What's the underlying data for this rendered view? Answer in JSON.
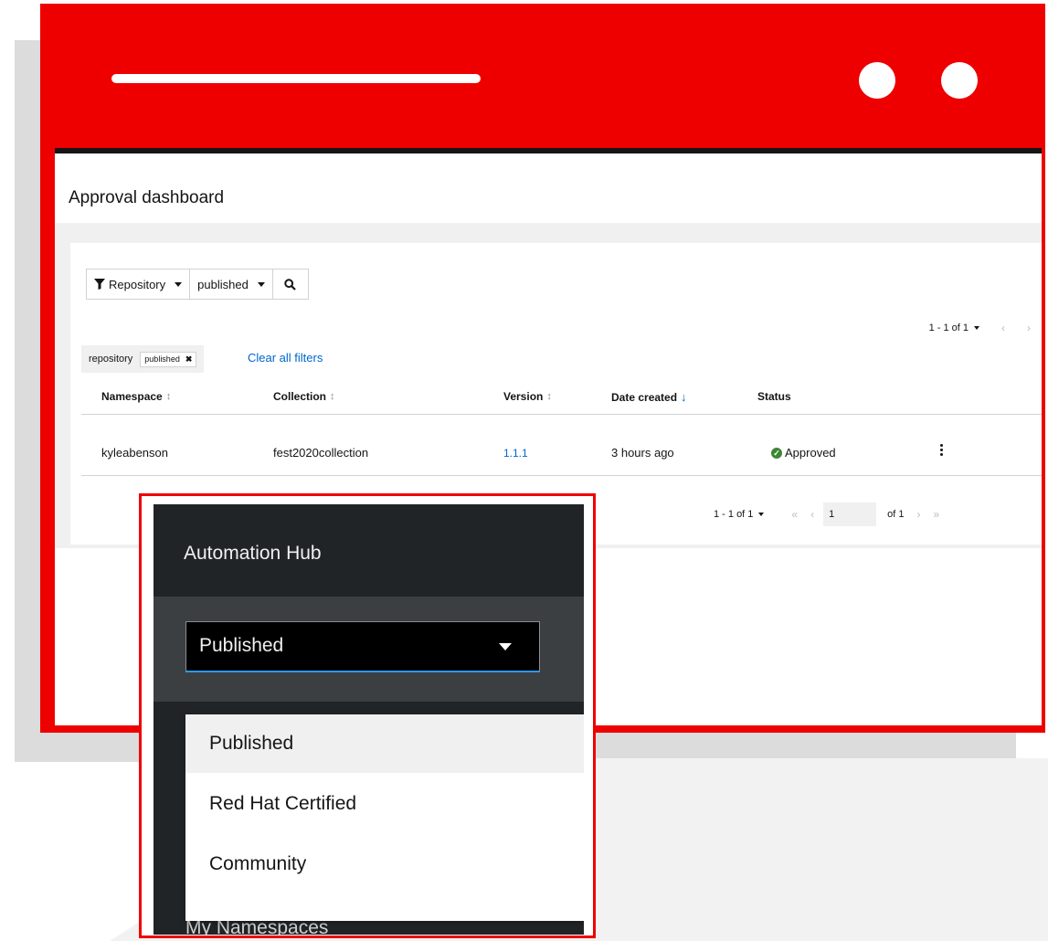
{
  "page": {
    "title": "Approval dashboard"
  },
  "toolbar": {
    "filter_label": "Repository",
    "filter_value": "published",
    "search_icon": "search-icon"
  },
  "pagination_top": {
    "range": "1 - 1 of 1"
  },
  "filters": {
    "chip_category": "repository",
    "chip_value": "published",
    "clear_label": "Clear all filters"
  },
  "table": {
    "headers": [
      "Namespace",
      "Collection",
      "Version",
      "Date created",
      "Status"
    ],
    "rows": [
      {
        "namespace": "kyleabenson",
        "collection": "fest2020collection",
        "version": "1.1.1",
        "date_created": "3 hours ago",
        "status": "Approved"
      }
    ]
  },
  "pagination_bottom": {
    "range": "1 - 1 of 1",
    "page": "1",
    "of_label": "of 1"
  },
  "sidebar": {
    "title": "Automation Hub",
    "selected_repository": "Published",
    "options": [
      "Published",
      "Red Hat Certified",
      "Community"
    ],
    "bottom_item": "My Namespaces"
  },
  "colors": {
    "brand_red": "#ee0000",
    "link_blue": "#0066cc",
    "success_green": "#3e8635",
    "sidebar_dark": "#212427"
  }
}
